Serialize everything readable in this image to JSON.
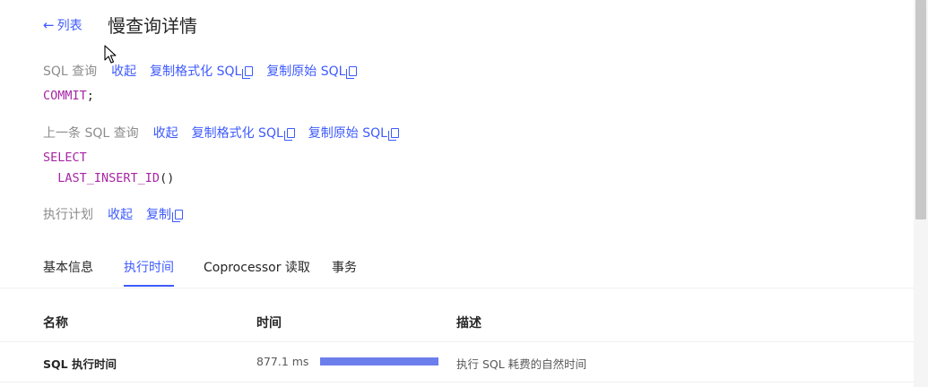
{
  "header": {
    "back_label": "列表",
    "title": "慢查询详情"
  },
  "sql_section": {
    "label": "SQL 查询",
    "collapse": "收起",
    "copy_formatted": "复制格式化 SQL",
    "copy_raw": "复制原始 SQL",
    "code_kw": "COMMIT",
    "code_rest": ";"
  },
  "prev_sql_section": {
    "label": "上一条 SQL 查询",
    "collapse": "收起",
    "copy_formatted": "复制格式化 SQL",
    "copy_raw": "复制原始 SQL",
    "code_line1_kw": "SELECT",
    "code_line2_kw": "LAST_INSERT_ID",
    "code_line2_rest": "()"
  },
  "plan_section": {
    "label": "执行计划",
    "collapse": "收起",
    "copy": "复制"
  },
  "tabs": [
    {
      "label": "基本信息"
    },
    {
      "label": "执行时间"
    },
    {
      "label": "Coprocessor 读取"
    },
    {
      "label": "事务"
    }
  ],
  "table": {
    "headers": {
      "name": "名称",
      "time": "时间",
      "desc": "描述"
    },
    "rows": [
      {
        "name": "SQL 执行时间",
        "time": "877.1 ms",
        "bar_fraction": 1.0,
        "desc": "执行 SQL 耗费的自然时间"
      }
    ]
  },
  "colors": {
    "link": "#3d5afe",
    "keyword": "#a626a4",
    "bar": "#6c7eec"
  }
}
